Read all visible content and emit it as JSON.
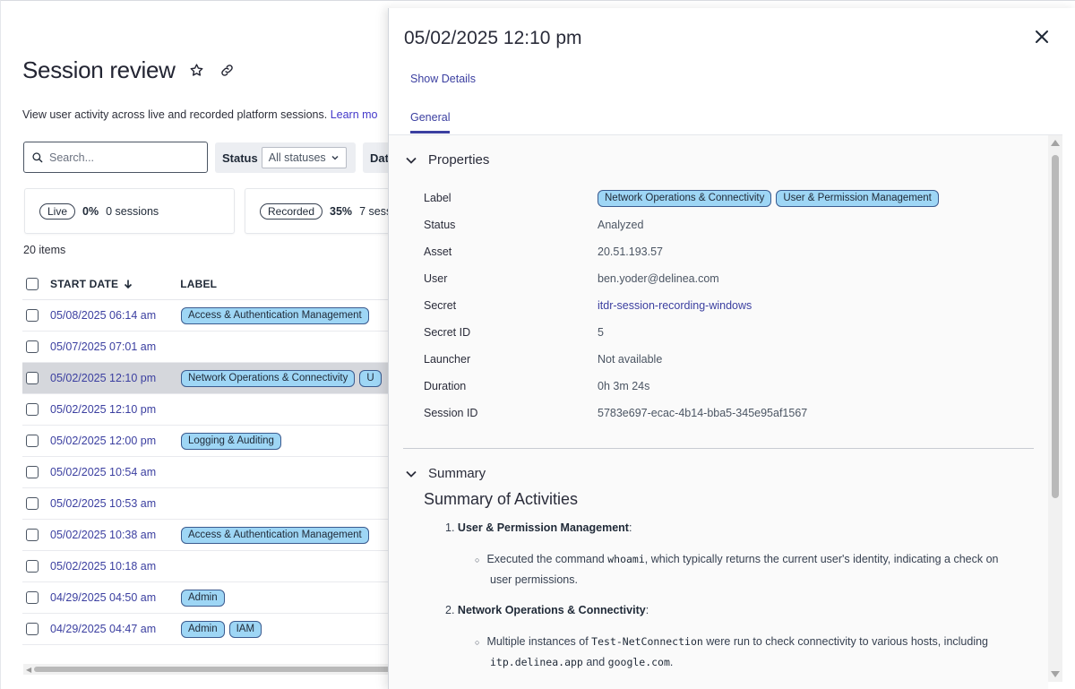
{
  "page": {
    "title": "Session review",
    "star_icon": "star-icon",
    "link_icon": "link-icon",
    "subtitle": "View user activity across live and recorded platform sessions.",
    "learn_more": "Learn mo",
    "search_placeholder": "Search...",
    "status_filter": {
      "label": "Status",
      "value": "All statuses"
    },
    "date_filter": {
      "label": "Dat"
    },
    "cards": [
      {
        "badge": "Live",
        "pct": "0%",
        "count": "0 sessions"
      },
      {
        "badge": "Recorded",
        "pct": "35%",
        "count": "7 sess"
      }
    ],
    "item_count": "20 items",
    "columns": {
      "start_date": "START DATE",
      "label": "LABEL"
    },
    "rows": [
      {
        "date": "05/08/2025 06:14 am",
        "labels": [
          "Access & Authentication Management"
        ]
      },
      {
        "date": "05/07/2025 07:01 am",
        "labels": []
      },
      {
        "date": "05/02/2025 12:10 pm",
        "labels": [
          "Network Operations & Connectivity",
          "U"
        ],
        "selected": true
      },
      {
        "date": "05/02/2025 12:10 pm",
        "labels": []
      },
      {
        "date": "05/02/2025 12:00 pm",
        "labels": [
          "Logging & Auditing"
        ]
      },
      {
        "date": "05/02/2025 10:54 am",
        "labels": []
      },
      {
        "date": "05/02/2025 10:53 am",
        "labels": []
      },
      {
        "date": "05/02/2025 10:38 am",
        "labels": [
          "Access & Authentication Management"
        ]
      },
      {
        "date": "05/02/2025 10:18 am",
        "labels": []
      },
      {
        "date": "04/29/2025 04:50 am",
        "labels": [
          "Admin"
        ]
      },
      {
        "date": "04/29/2025 04:47 am",
        "labels": [
          "Admin",
          "IAM"
        ]
      }
    ]
  },
  "drawer": {
    "title": "05/02/2025 12:10 pm",
    "show_details": "Show Details",
    "tab": "General",
    "properties_heading": "Properties",
    "properties": {
      "label_key": "Label",
      "labels": [
        "Network Operations & Connectivity",
        "User & Permission Management"
      ],
      "status_key": "Status",
      "status": "Analyzed",
      "asset_key": "Asset",
      "asset": "20.51.193.57",
      "user_key": "User",
      "user": "ben.yoder@delinea.com",
      "secret_key": "Secret",
      "secret": "itdr-session-recording-windows",
      "secret_id_key": "Secret ID",
      "secret_id": "5",
      "launcher_key": "Launcher",
      "launcher": "Not available",
      "duration_key": "Duration",
      "duration": "0h 3m 24s",
      "session_id_key": "Session ID",
      "session_id": "5783e697-ecac-4b14-bba5-345e95af1567"
    },
    "summary_heading": "Summary",
    "summary_title": "Summary of Activities",
    "summary": {
      "item1_num": "1.",
      "item1_title": "User & Permission Management",
      "item1_colon": ":",
      "item1_text_a": "Executed the command ",
      "item1_code": "whoami",
      "item1_text_b": ", which typically returns the current user's identity, indicating a check on",
      "item1_text_c": "user permissions.",
      "item2_num": "2.",
      "item2_title": "Network Operations & Connectivity",
      "item2_colon": ":",
      "item2_text_a": "Multiple instances of ",
      "item2_code": "Test-NetConnection",
      "item2_text_b": " were run to check connectivity to various hosts, including",
      "item2_code2": "itp.delinea.app",
      "item2_text_c": " and ",
      "item2_code3": "google.com",
      "item2_text_d": "."
    }
  },
  "colors": {
    "accent": "#3b3fa0",
    "tag_bg": "#9ed6f5",
    "tag_border": "#3b5b8f",
    "selected_row": "#d5d7dc"
  }
}
